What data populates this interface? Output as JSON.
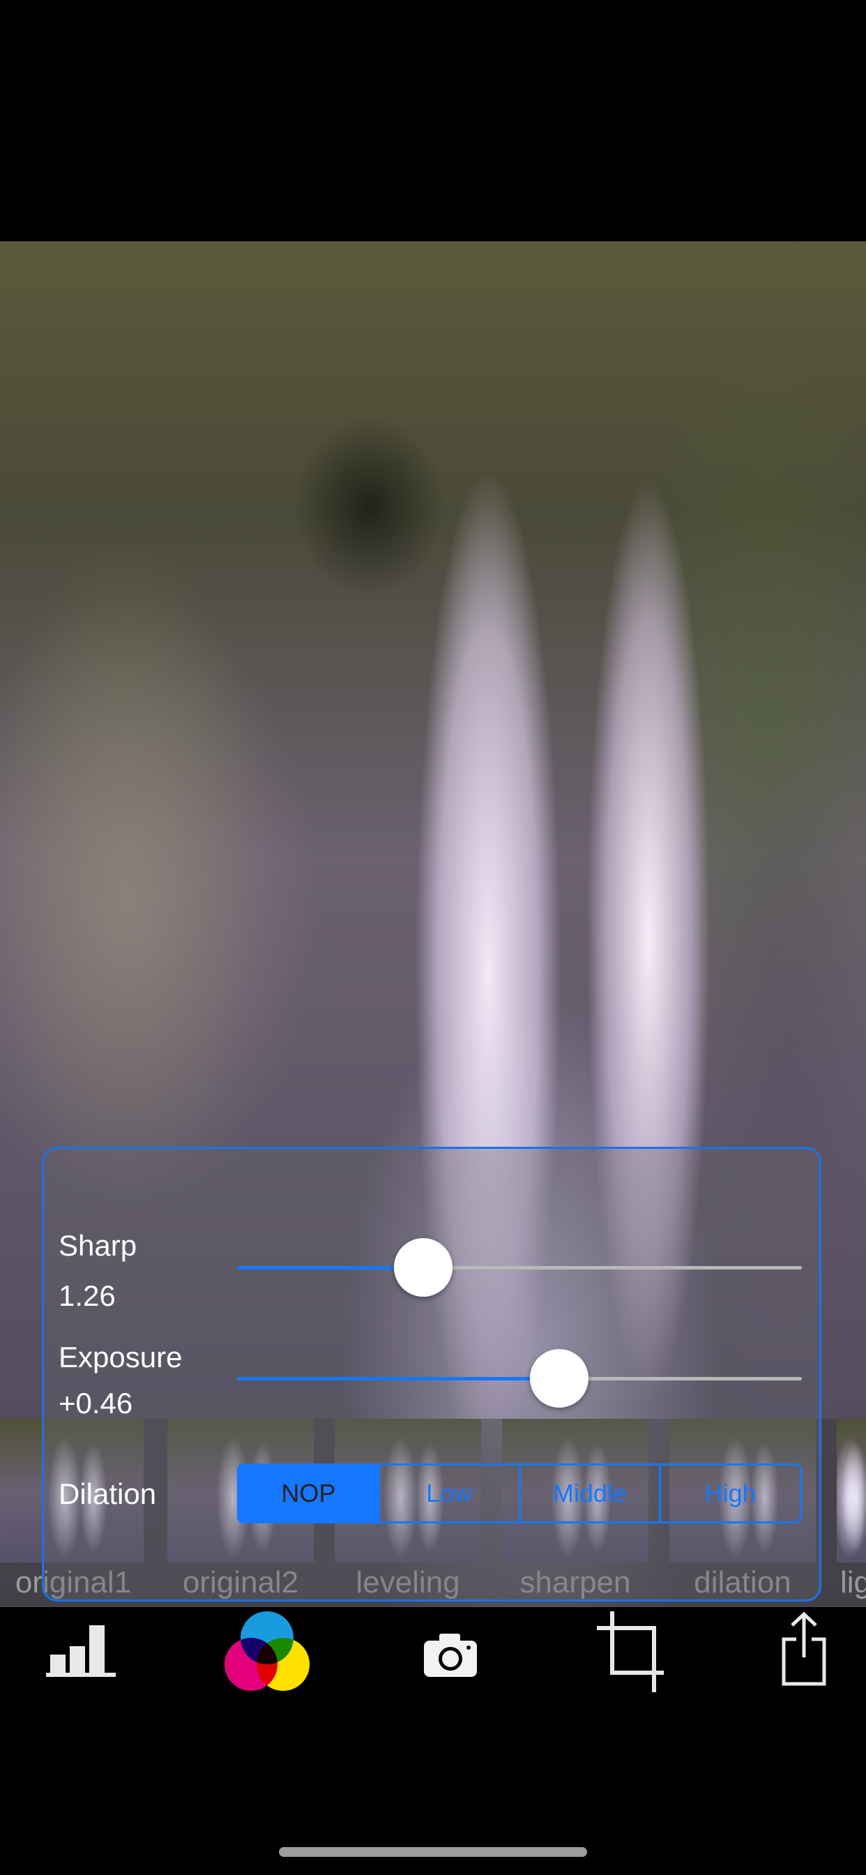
{
  "controls": {
    "sharp": {
      "label": "Sharp",
      "value": "1.26",
      "position": 0.33
    },
    "exposure": {
      "label": "Exposure",
      "value": "+0.46",
      "position": 0.57
    },
    "dilation": {
      "label": "Dilation",
      "options": [
        "NOP",
        "Low",
        "Middle",
        "High"
      ],
      "selected": "NOP"
    }
  },
  "thumbnails": [
    {
      "label": "original1"
    },
    {
      "label": "original2"
    },
    {
      "label": "leveling"
    },
    {
      "label": "sharpen"
    },
    {
      "label": "dilation"
    },
    {
      "label": "lig"
    }
  ],
  "toolbar": {
    "items": [
      {
        "icon": "histogram-icon"
      },
      {
        "icon": "color-filter-icon"
      },
      {
        "icon": "camera-icon"
      },
      {
        "icon": "crop-icon"
      },
      {
        "icon": "share-icon"
      }
    ]
  },
  "colors": {
    "accent": "#1677ff"
  }
}
